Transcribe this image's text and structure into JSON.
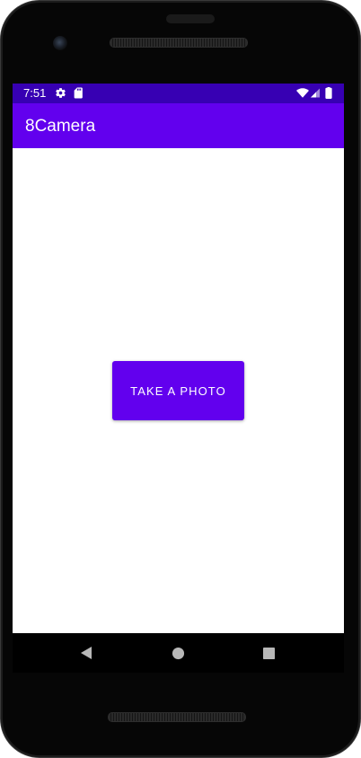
{
  "status_bar": {
    "time": "7:51",
    "background": "#3700b3",
    "left_icons": [
      "settings-gear-icon",
      "sd-card-icon"
    ],
    "right_icons": [
      "wifi-icon",
      "cellular-signal-icon",
      "battery-icon"
    ]
  },
  "app_bar": {
    "title": "8Camera",
    "background": "#6200ee"
  },
  "main": {
    "take_photo_label": "TAKE A PHOTO",
    "button_color": "#6200ee"
  },
  "nav_bar": {
    "buttons": [
      "back-icon",
      "home-icon",
      "recents-icon"
    ]
  }
}
